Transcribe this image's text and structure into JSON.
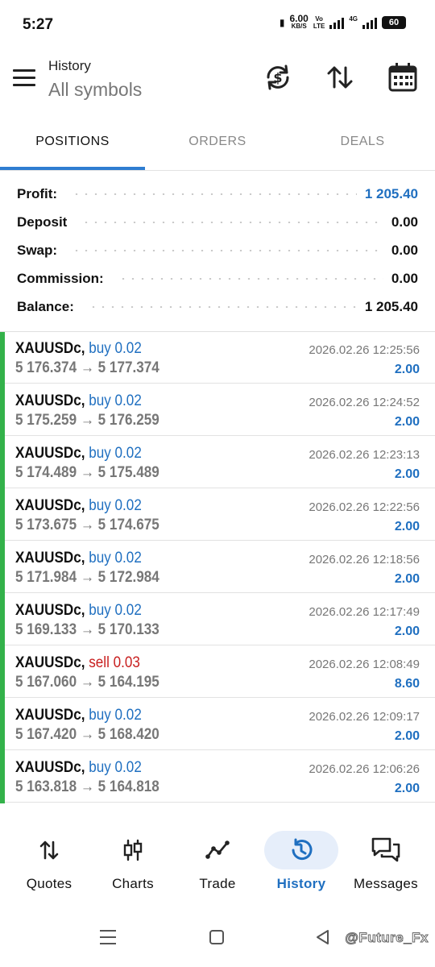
{
  "status_bar": {
    "time": "5:27",
    "speed_value": "6.00",
    "speed_unit": "KB/S",
    "network_label_top": "Vo",
    "network_label_bottom": "LTE",
    "data_label": "4G",
    "battery": "60"
  },
  "header": {
    "title": "History",
    "subtitle": "All symbols",
    "icons": [
      "sync-currency-icon",
      "sort-icon",
      "calendar-icon"
    ]
  },
  "tabs": [
    {
      "label": "POSITIONS",
      "active": true
    },
    {
      "label": "ORDERS",
      "active": false
    },
    {
      "label": "DEALS",
      "active": false
    }
  ],
  "summary": [
    {
      "label": "Profit:",
      "value": "1 205.40",
      "accent": true
    },
    {
      "label": "Deposit",
      "value": "0.00",
      "accent": false
    },
    {
      "label": "Swap:",
      "value": "0.00",
      "accent": false
    },
    {
      "label": "Commission:",
      "value": "0.00",
      "accent": false
    },
    {
      "label": "Balance:",
      "value": "1 205.40",
      "accent": false
    }
  ],
  "positions": [
    {
      "symbol": "XAUUSDc,",
      "side": "buy 0.02",
      "type": "buy",
      "prices": "5 176.374 → 5 177.374",
      "time": "2026.02.26 12:25:56",
      "profit": "2.00"
    },
    {
      "symbol": "XAUUSDc,",
      "side": "buy 0.02",
      "type": "buy",
      "prices": "5 175.259 → 5 176.259",
      "time": "2026.02.26 12:24:52",
      "profit": "2.00"
    },
    {
      "symbol": "XAUUSDc,",
      "side": "buy 0.02",
      "type": "buy",
      "prices": "5 174.489 → 5 175.489",
      "time": "2026.02.26 12:23:13",
      "profit": "2.00"
    },
    {
      "symbol": "XAUUSDc,",
      "side": "buy 0.02",
      "type": "buy",
      "prices": "5 173.675 → 5 174.675",
      "time": "2026.02.26 12:22:56",
      "profit": "2.00"
    },
    {
      "symbol": "XAUUSDc,",
      "side": "buy 0.02",
      "type": "buy",
      "prices": "5 171.984 → 5 172.984",
      "time": "2026.02.26 12:18:56",
      "profit": "2.00"
    },
    {
      "symbol": "XAUUSDc,",
      "side": "buy 0.02",
      "type": "buy",
      "prices": "5 169.133 → 5 170.133",
      "time": "2026.02.26 12:17:49",
      "profit": "2.00"
    },
    {
      "symbol": "XAUUSDc,",
      "side": "sell 0.03",
      "type": "sell",
      "prices": "5 167.060 → 5 164.195",
      "time": "2026.02.26 12:08:49",
      "profit": "8.60"
    },
    {
      "symbol": "XAUUSDc,",
      "side": "buy 0.02",
      "type": "buy",
      "prices": "5 167.420 → 5 168.420",
      "time": "2026.02.26 12:09:17",
      "profit": "2.00"
    },
    {
      "symbol": "XAUUSDc,",
      "side": "buy 0.02",
      "type": "buy",
      "prices": "5 163.818 → 5 164.818",
      "time": "2026.02.26 12:06:26",
      "profit": "2.00"
    }
  ],
  "bottom_nav": [
    {
      "label": "Quotes",
      "icon": "quotes-icon",
      "active": false
    },
    {
      "label": "Charts",
      "icon": "charts-icon",
      "active": false
    },
    {
      "label": "Trade",
      "icon": "trade-icon",
      "active": false
    },
    {
      "label": "History",
      "icon": "history-icon",
      "active": true
    },
    {
      "label": "Messages",
      "icon": "messages-icon",
      "active": false
    }
  ],
  "watermark": "@Future_Fx",
  "colors": {
    "accent_blue": "#1f6fc0",
    "sell_red": "#c81e1e",
    "position_edge_green": "#33b24a",
    "tab_indicator": "#2e7dd1"
  }
}
